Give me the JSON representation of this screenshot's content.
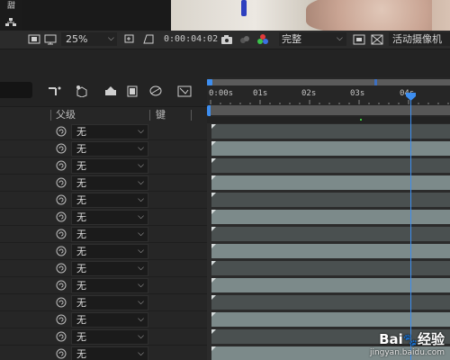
{
  "top_strip": {
    "glyph_top": "甜",
    "glyph_bottom": "品"
  },
  "viewer_toolbar": {
    "zoom": "25%",
    "timecode": "0:00:04:02",
    "quality": "完整",
    "view_mode": "活动摄像机"
  },
  "timeline": {
    "ticks": [
      "0:00s",
      "01s",
      "02s",
      "03s",
      "04s"
    ]
  },
  "columns": {
    "parent": "父级",
    "keys": "键"
  },
  "layers": [
    {
      "parent": "无"
    },
    {
      "parent": "无"
    },
    {
      "parent": "无"
    },
    {
      "parent": "无"
    },
    {
      "parent": "无"
    },
    {
      "parent": "无"
    },
    {
      "parent": "无"
    },
    {
      "parent": "无"
    },
    {
      "parent": "无"
    },
    {
      "parent": "无"
    },
    {
      "parent": "无"
    },
    {
      "parent": "无"
    },
    {
      "parent": "无"
    },
    {
      "parent": "无"
    }
  ],
  "layer_bars": [
    {
      "color": "#4a5050"
    },
    {
      "color": "#7c8a8a"
    },
    {
      "color": "#4a5050"
    },
    {
      "color": "#7c8a8a"
    },
    {
      "color": "#4a5050"
    },
    {
      "color": "#7c8a8a"
    },
    {
      "color": "#4a5050"
    },
    {
      "color": "#7c8a8a"
    },
    {
      "color": "#4a5050"
    },
    {
      "color": "#7c8a8a"
    },
    {
      "color": "#4a5050"
    },
    {
      "color": "#7c8a8a"
    },
    {
      "color": "#4a5050"
    },
    {
      "color": "#7c8a8a"
    }
  ],
  "colors": {
    "accent_blue": "#3d8ef0",
    "playhead": "#3d8ef0",
    "work_area": "#575757",
    "green_marker": "#3cc93c"
  },
  "watermark": {
    "brand": "Bai",
    "brand_suffix": "经验",
    "url": "jingyan.baidu.com"
  }
}
